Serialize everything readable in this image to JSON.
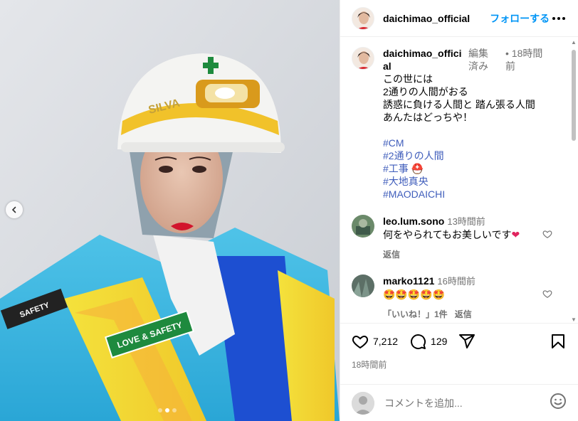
{
  "post": {
    "username": "daichimao_official",
    "follow_label": "フォローする",
    "caption": {
      "username": "daichimao_official",
      "edited": "編集済み",
      "time": "• 18時間前",
      "lines": [
        "この世には",
        "2通りの人間がおる",
        "誘惑に負ける人間と 踏ん張る人間",
        "あんたはどっちや！"
      ],
      "hashtags": [
        "#CM",
        "#2通りの人間",
        "#工事",
        "#大地真央",
        "#MAODAICHI"
      ]
    },
    "comments": [
      {
        "username": "leo.lum.sono",
        "time": "13時間前",
        "text": "何をやられてもお美しいです",
        "reply_label": "返信",
        "likes_label": ""
      },
      {
        "username": "marko1121",
        "time": "16時間前",
        "text": "🤩🤩🤩🤩🤩",
        "likes_label": "「いいね！」1件",
        "reply_label": "返信"
      }
    ],
    "actions": {
      "likes": "7,212",
      "comments": "129"
    },
    "timestamp": "18時間前",
    "add_comment_placeholder": "コメントを追加...",
    "media": {
      "vest_patch_text": "LOVE & SAFETY",
      "arm_patch_text": "SAFETY",
      "helmet_text": "SILVA",
      "carousel_dots": 3,
      "active_dot": 2
    }
  },
  "icons": {
    "heart": "heart-icon",
    "comment": "comment-icon",
    "share": "share-icon",
    "save": "bookmark-icon",
    "emoji": "emoji-icon",
    "more": "more-icon",
    "prev": "chevron-left-icon"
  },
  "colors": {
    "follow": "#0095f6",
    "hashtag": "#3f5dbb",
    "red_heart": "#e0245e"
  }
}
